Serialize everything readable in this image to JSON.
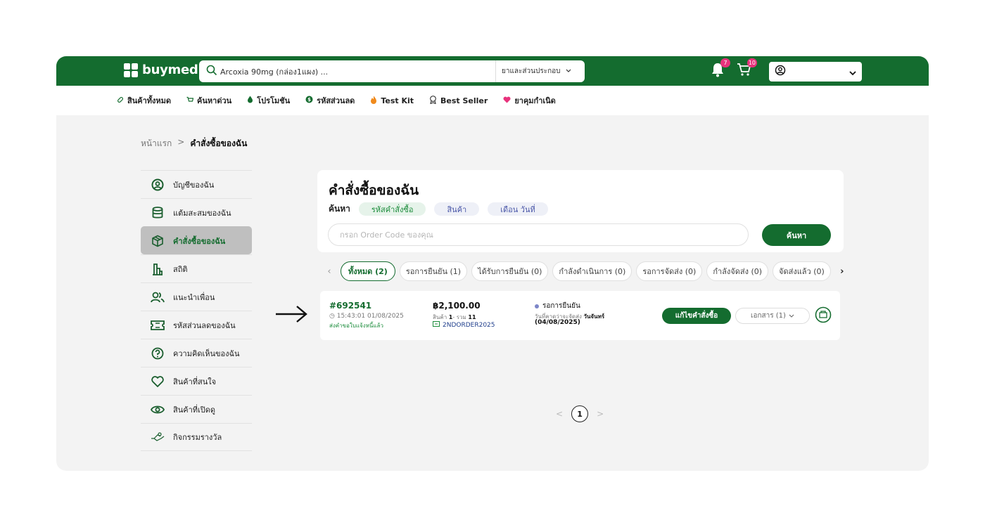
{
  "brand": {
    "name": "buymed"
  },
  "search": {
    "value": "Arcoxia 90mg (กล่อง1แผง) ...",
    "category": "ยาและส่วนประกอบ"
  },
  "header": {
    "notification_count": "7",
    "cart_count": "10"
  },
  "category_nav": [
    {
      "label": "สินค้าทั้งหมด",
      "icon": "pill-icon"
    },
    {
      "label": "ค้นหาด่วน",
      "icon": "cart-icon"
    },
    {
      "label": "โปรโมชัน",
      "icon": "drop-icon"
    },
    {
      "label": "รหัสส่วนลด",
      "icon": "coupon-icon"
    },
    {
      "label": "Test Kit",
      "icon": "flame-icon"
    },
    {
      "label": "Best Seller",
      "icon": "badge-icon"
    },
    {
      "label": "ยาคุมกำเนิด",
      "icon": "heart-icon"
    }
  ],
  "breadcrumb": {
    "home": "หน้าแรก",
    "separator": ">",
    "current": "คำสั่งซื้อของฉัน"
  },
  "sidebar": [
    {
      "label": "บัญชีของฉัน",
      "icon": "user-circle-icon"
    },
    {
      "label": "แต้มสะสมของฉัน",
      "icon": "database-icon"
    },
    {
      "label": "คำสั่งซื้อของฉัน",
      "icon": "package-icon"
    },
    {
      "label": "สถิติ",
      "icon": "bar-chart-icon"
    },
    {
      "label": "แนะนำเพื่อน",
      "icon": "users-icon"
    },
    {
      "label": "รหัสส่วนลดของฉัน",
      "icon": "ticket-icon"
    },
    {
      "label": "ความคิดเห็นของฉัน",
      "icon": "question-icon"
    },
    {
      "label": "สินค้าที่สนใจ",
      "icon": "heart-outline-icon"
    },
    {
      "label": "สินค้าที่เปิดดู",
      "icon": "eye-icon"
    },
    {
      "label": "กิจกรรมรางวัล",
      "icon": "gift-icon"
    }
  ],
  "orders": {
    "title": "คำสั่งซื้อของฉัน",
    "search_label": "ค้นหา",
    "filters": [
      "รหัสคำสั่งซื้อ",
      "สินค้า",
      "เดือน วันที่"
    ],
    "input_placeholder": "กรอก Order Code ของคุณ",
    "search_button": "ค้นหา"
  },
  "tabs": [
    "ทั้งหมด (2)",
    "รอการยืนยัน (1)",
    "ได้รับการยืนยัน (0)",
    "กำลังดำเนินการ (0)",
    "รอการจัดส่ง (0)",
    "กำลังจัดส่ง (0)",
    "จัดส่งแล้ว (0)"
  ],
  "order": {
    "code": "#692541",
    "time": "15:43:01 01/08/2025",
    "note": "ส่งคำขอใบแจ้งหนี้แล้ว",
    "amount": "฿2,100.00",
    "items_label": "สินค้า",
    "items_count": "1",
    "total_label": "- รวม",
    "total_qty": "11",
    "voucher": "2NDORDER2025",
    "status": "รอการยืนยัน",
    "expected_label": "วันที่คาดว่าจะจัดส่ง",
    "expected_day": "วันจันทร์",
    "expected_date": "(04/08/2025)",
    "edit_button": "แก้ไขคำสั่งซื้อ",
    "docs_button": "เอกสาร (1)"
  },
  "pagination": {
    "current": "1",
    "prev": "<",
    "next": ">"
  },
  "colors": {
    "brand_green": "#146c2f",
    "badge_pink": "#e8327c",
    "status_dot": "#7d86c8"
  }
}
